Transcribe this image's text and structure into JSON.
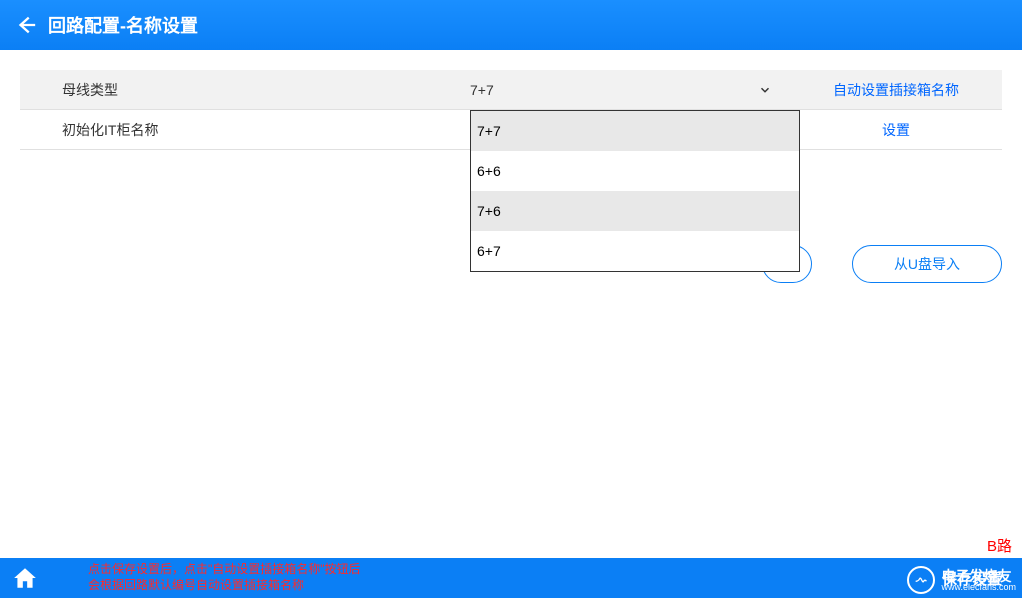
{
  "header": {
    "title": "回路配置-名称设置"
  },
  "table": {
    "row1": {
      "label": "母线类型",
      "selected": "7+7",
      "action": "自动设置插接箱名称"
    },
    "row2": {
      "label": "初始化IT柜名称",
      "action": "设置"
    }
  },
  "dropdown": {
    "options": [
      "7+7",
      "6+6",
      "7+6",
      "6+7"
    ]
  },
  "buttons": {
    "import_usb": "从U盘导入"
  },
  "footer": {
    "tip_line1": "点击保存设置后，点击\"自动设置插接箱名称\"按钮后",
    "tip_line2": "会根据回路默认编号自动设置插接箱名称",
    "save": "保存设置"
  },
  "route_badge": "B路",
  "watermark": {
    "cn": "电子发烧友",
    "en": "www.elecfans.com"
  }
}
